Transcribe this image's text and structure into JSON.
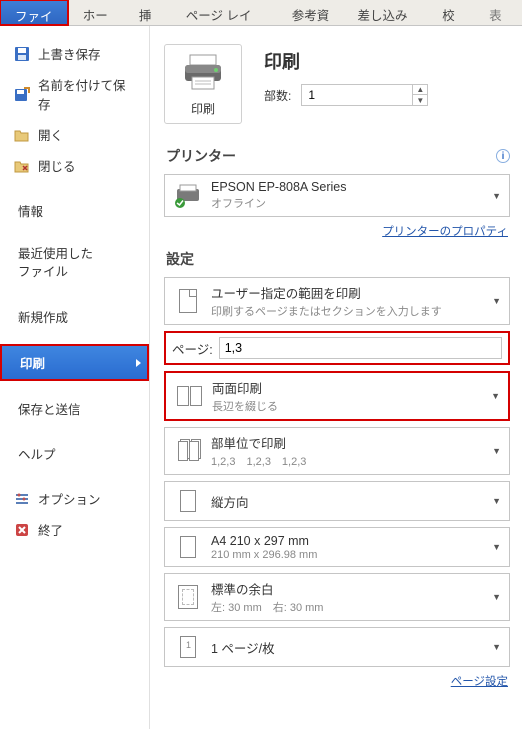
{
  "ribbon": {
    "file": "ファイル",
    "home": "ホーム",
    "insert": "挿入",
    "layout": "ページ レイアウト",
    "reference": "参考資料",
    "mailmerge": "差し込み文書",
    "review": "校閲",
    "view": "表示"
  },
  "sidebar": {
    "save_overwrite": "上書き保存",
    "save_as": "名前を付けて保存",
    "open": "開く",
    "close": "閉じる",
    "info": "情報",
    "recent1": "最近使用した",
    "recent2": "ファイル",
    "new": "新規作成",
    "print": "印刷",
    "save_send": "保存と送信",
    "help": "ヘルプ",
    "options": "オプション",
    "exit": "終了"
  },
  "print": {
    "button_label": "印刷",
    "title": "印刷",
    "copies_label": "部数:",
    "copies_value": "1"
  },
  "printer": {
    "header": "プリンター",
    "name": "EPSON EP-808A Series",
    "status": "オフライン",
    "properties_link": "プリンターのプロパティ"
  },
  "settings": {
    "header": "設定",
    "range_title": "ユーザー指定の範囲を印刷",
    "range_sub": "印刷するページまたはセクションを入力します",
    "pages_label": "ページ:",
    "pages_value": "1,3",
    "duplex_title": "両面印刷",
    "duplex_sub": "長辺を綴じる",
    "collate_title": "部単位で印刷",
    "collate_sub": "1,2,3　1,2,3　1,2,3",
    "orient_title": "縦方向",
    "paper_title": "A4 210 x 297 mm",
    "paper_sub": "210 mm x 296.98 mm",
    "margin_title": "標準の余白",
    "margin_sub": "左: 30 mm　右: 30 mm",
    "perpage_title": "1 ページ/枚",
    "page_setup_link": "ページ設定"
  }
}
